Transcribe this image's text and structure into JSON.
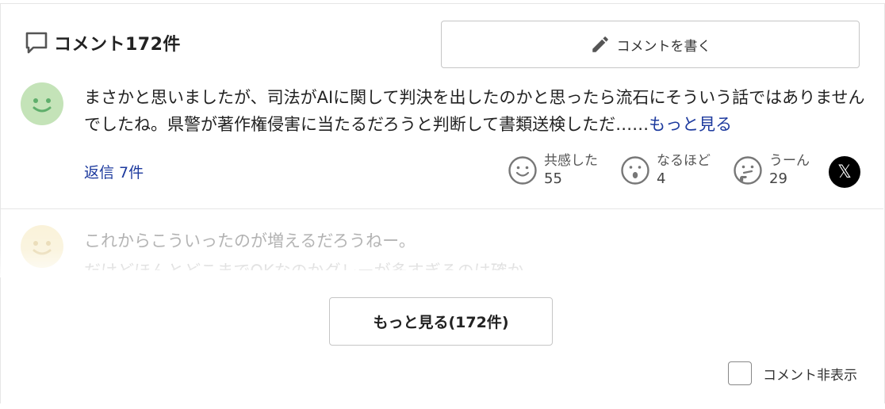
{
  "header": {
    "title": "コメント172件",
    "icon": "comment-bubble-icon"
  },
  "write_button": {
    "label": "コメントを書く",
    "icon": "pencil-icon"
  },
  "comments": [
    {
      "avatar": "smiley-avatar-green",
      "avatar_color": "#bfe0b3",
      "text_main": "まさかと思いましたが、司法がAIに関して判決を出したのかと思ったら流石にそういう話ではありませんでしたね。県警が著作権侵害に当たるだろうと判断して書類送検しただ……",
      "more_label": "もっと見る",
      "reply_label": "返信 7件",
      "reactions": [
        {
          "label": "共感した",
          "count": "55",
          "icon": "smile-face-icon"
        },
        {
          "label": "なるほど",
          "count": "4",
          "icon": "surprised-face-icon"
        },
        {
          "label": "うーん",
          "count": "29",
          "icon": "thinking-face-icon"
        }
      ],
      "share_icon": "x-logo-icon",
      "share_glyph": "𝕏"
    },
    {
      "avatar": "smiley-avatar-yellow",
      "avatar_color": "#f0e3b0",
      "line1": "これからこういったのが増えるだろうねー。",
      "line2": "だけどほんとどこまでOKなのかグレーが多すぎるのは確か。"
    }
  ],
  "more_button": {
    "label": "もっと見る(172件)"
  },
  "hide_comments": {
    "label": "コメント非表示",
    "checked": false
  },
  "colors": {
    "link": "#1d3a9e",
    "border": "#c6c6c6"
  }
}
